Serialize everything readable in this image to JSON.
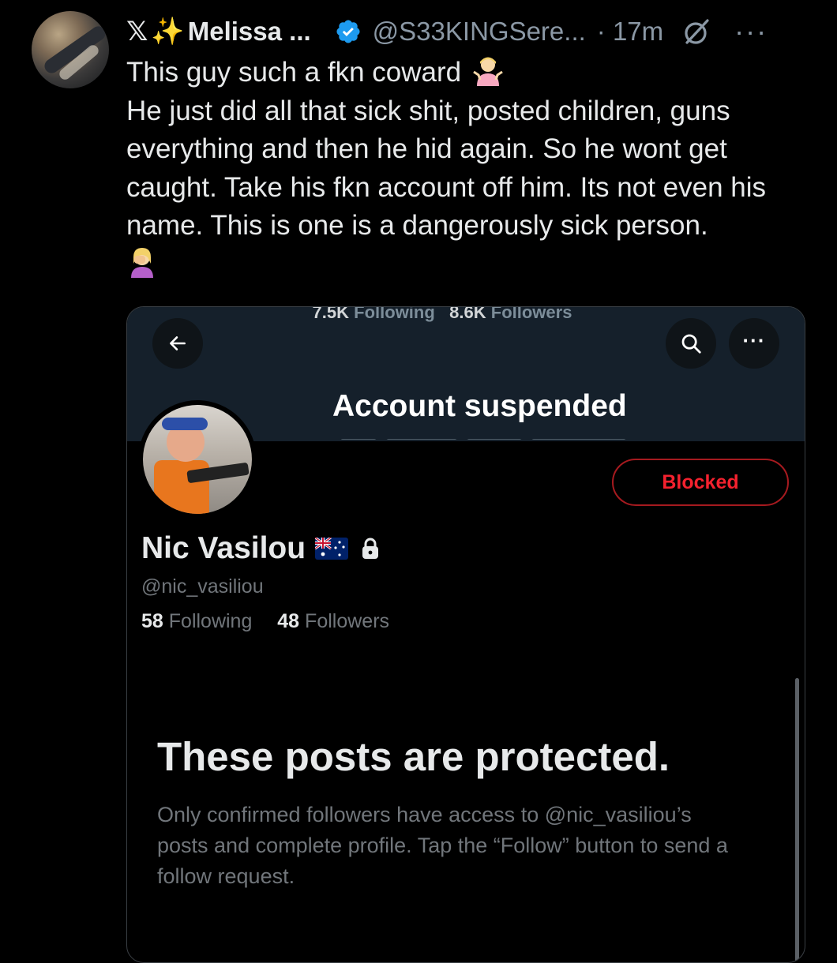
{
  "tweet": {
    "author_name": "Melissa ...",
    "handle": "@S33KINGSere...",
    "time": "· 17m",
    "more": "···",
    "lines": [
      "This guy such a fkn coward",
      "He just did all that sick shit, posted children, guns everything and then he hid again. So he wont get caught. Take his fkn account off him. Its not even his name. This is one is a dangerously sick person."
    ]
  },
  "screenshot": {
    "banner_stats": {
      "following_value": "7.5K",
      "following_label": "Following",
      "followers_value": "8.6K",
      "followers_label": "Followers"
    },
    "suspended_title": "Account suspended",
    "blocked_label": "Blocked",
    "more_label": "···",
    "profile_name": "Nic Vasilou",
    "profile_handle": "@nic_vasiliou",
    "following_count": "58",
    "following_label": "Following",
    "followers_count": "48",
    "followers_label": "Followers",
    "protected_title": "These posts are protected.",
    "protected_body": "Only confirmed followers have access to @nic_vasiliou’s posts and complete profile. Tap the “Follow” button to send a follow request."
  },
  "icons": {
    "x_logo": "x-logo-icon",
    "sparkle": "sparkle-icon",
    "verified": "verified-badge-icon",
    "grok": "grok-icon",
    "shrug_emoji": "person-shrugging-emoji",
    "facepalm_emoji": "person-facepalming-emoji",
    "back": "arrow-left-icon",
    "search": "search-icon",
    "flag": "australia-flag-icon",
    "lock": "lock-icon"
  },
  "colors": {
    "background": "#000000",
    "text_primary": "#e7e9ea",
    "text_secondary": "#71767b",
    "verified_blue": "#1d9bf0",
    "blocked_red": "#f4212e",
    "banner": "#15202b"
  }
}
